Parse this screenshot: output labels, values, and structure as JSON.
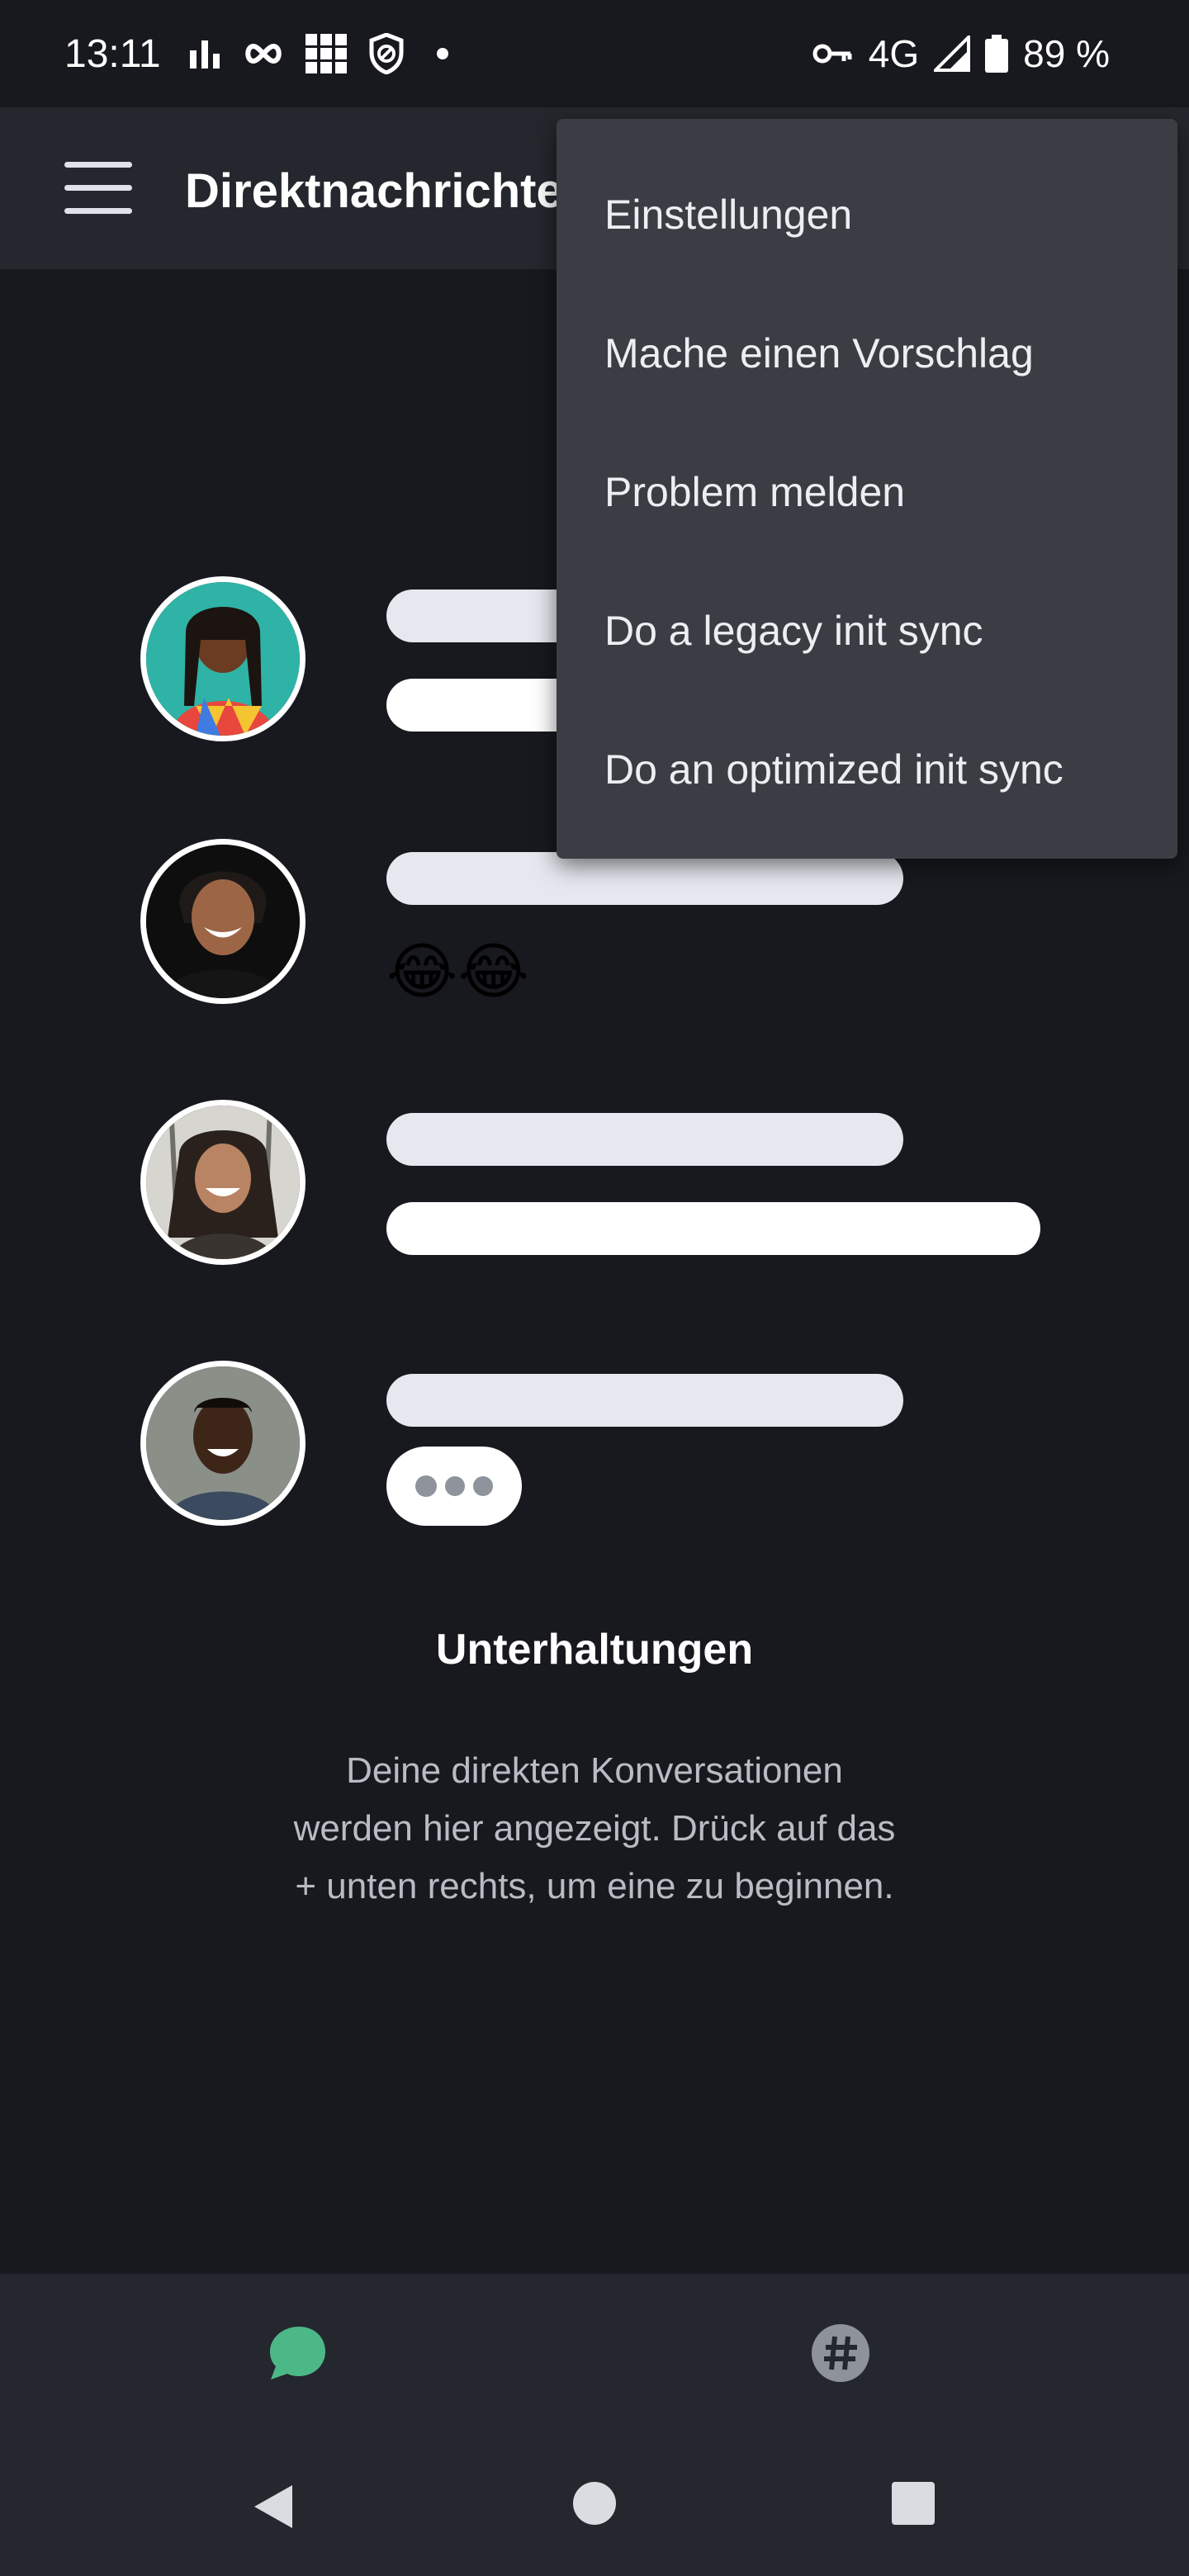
{
  "status_bar": {
    "time": "13:11",
    "network": "4G",
    "battery": "89 %",
    "icons": [
      "bar-chart-icon",
      "infinity-icon",
      "grid-icon",
      "shield-icon",
      "dot-icon",
      "key-icon",
      "signal-icon",
      "battery-icon"
    ]
  },
  "app_bar": {
    "title": "Direktnachrichten",
    "menu_icon": "hamburger-icon"
  },
  "overflow_menu": {
    "items": [
      {
        "label": "Einstellungen"
      },
      {
        "label": "Mache einen Vorschlag"
      },
      {
        "label": "Problem melden"
      },
      {
        "label": "Do a legacy init sync"
      },
      {
        "label": "Do an optimized init sync"
      }
    ]
  },
  "illustration": {
    "emoji": "😂😂"
  },
  "empty_state": {
    "title": "Unterhaltungen",
    "description": "Deine direkten Konversationen werden hier angezeigt. Drück auf das + unten rechts, um eine zu beginnen."
  },
  "fab": {
    "icon": "new-message-icon"
  },
  "bottom_nav": {
    "tabs": [
      {
        "icon": "chat-bubble-icon",
        "active": true
      },
      {
        "icon": "hashtag-icon",
        "active": false
      }
    ]
  },
  "colors": {
    "background": "#17191e",
    "surface": "#24272d",
    "menu": "#3a3d44",
    "accent": "#4cb888"
  }
}
